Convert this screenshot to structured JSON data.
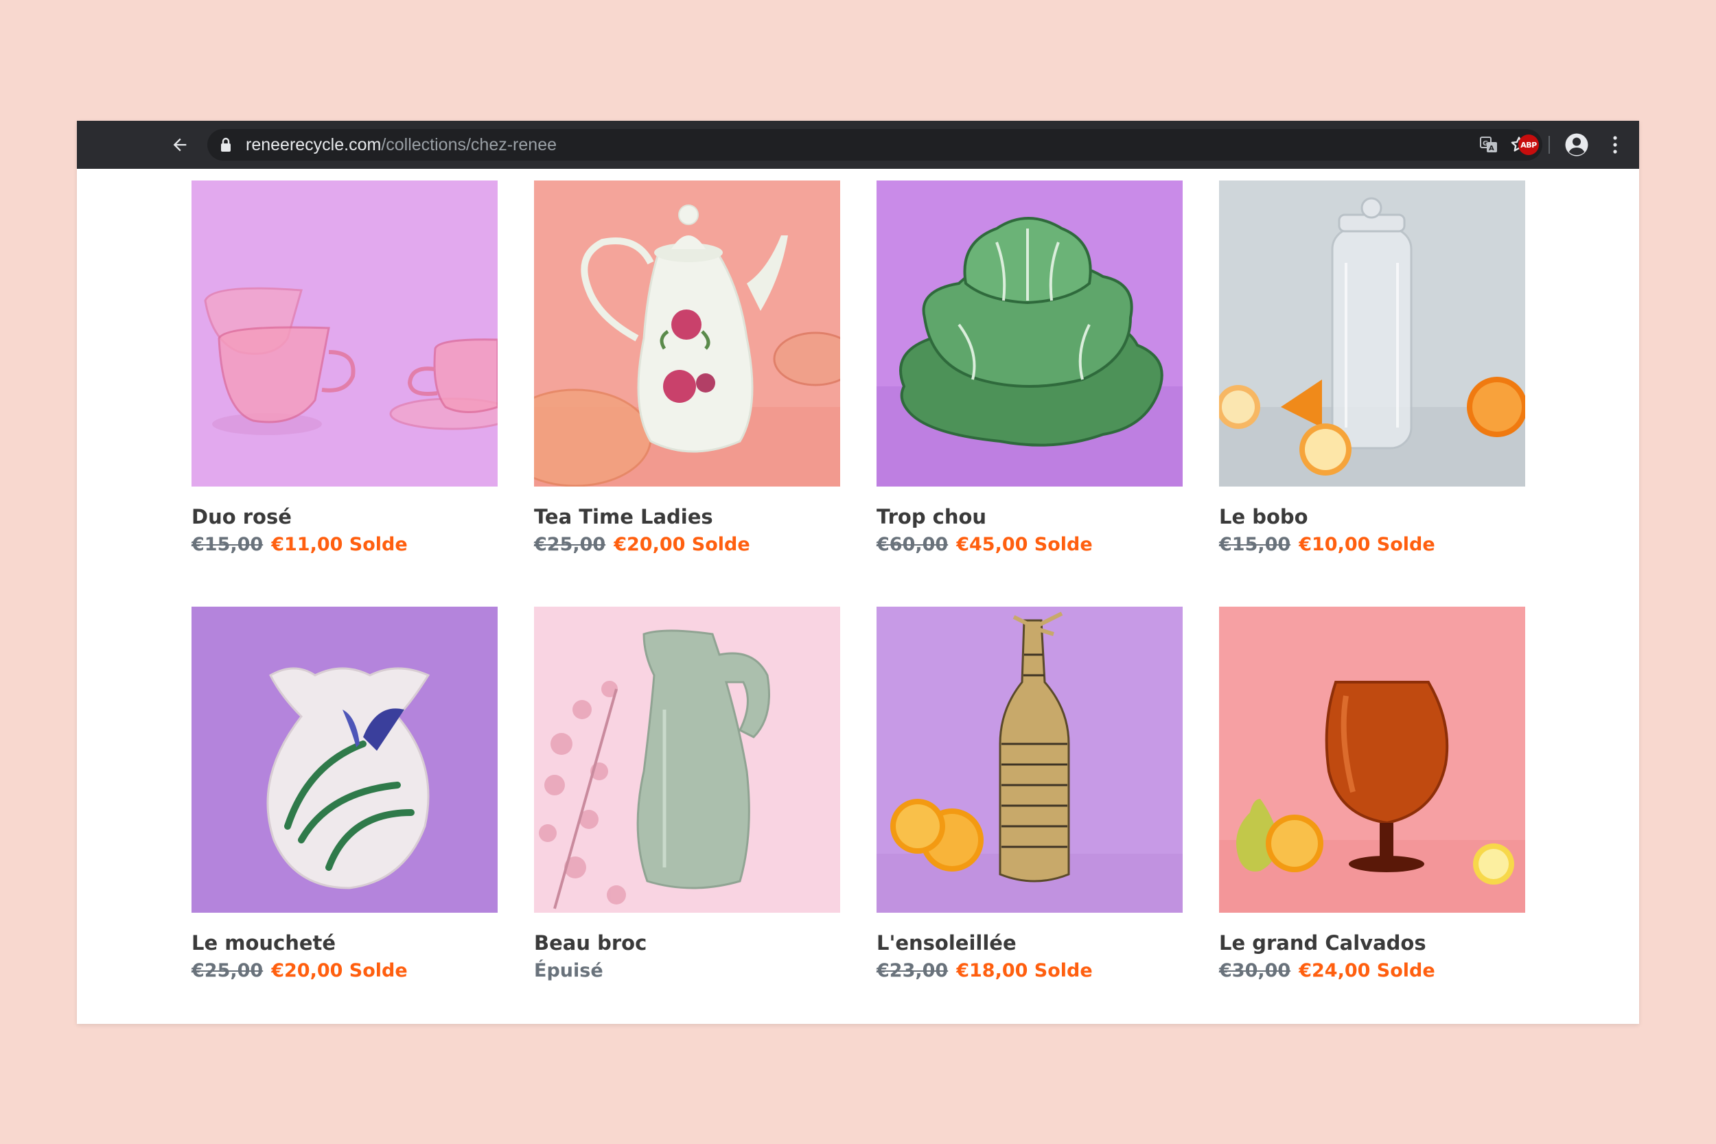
{
  "browser": {
    "url_host": "reneerecycle.com",
    "url_path": "/collections/chez-renee",
    "extension_label": "ABP"
  },
  "products": [
    {
      "title": "Duo rosé",
      "old_price": "€15,00",
      "price": "€11,00 Solde",
      "bg": "#e2a9ee"
    },
    {
      "title": "Tea Time Ladies",
      "old_price": "€25,00",
      "price": "€20,00 Solde",
      "bg": "#f4a49a"
    },
    {
      "title": "Trop chou",
      "old_price": "€60,00",
      "price": "€45,00 Solde",
      "bg": "#c98be8"
    },
    {
      "title": "Le bobo",
      "old_price": "€15,00",
      "price": "€10,00 Solde",
      "bg": "#cfd6da"
    },
    {
      "title": "Le moucheté",
      "old_price": "€25,00",
      "price": "€20,00 Solde",
      "bg": "#b484dc"
    },
    {
      "title": "Beau broc",
      "status": "Épuisé",
      "bg": "#f9d4e2"
    },
    {
      "title": "L'ensoleillée",
      "old_price": "€23,00",
      "price": "€18,00 Solde",
      "bg": "#c79ae6"
    },
    {
      "title": "Le grand Calvados",
      "old_price": "€30,00",
      "price": "€24,00 Solde",
      "bg": "#f6a0a3"
    }
  ],
  "colors": {
    "page_bg": "#f8d8cf",
    "toolbar": "#2b2c30",
    "sale": "#ff5f0f",
    "muted": "#69727b",
    "title": "#3a3a3a"
  }
}
